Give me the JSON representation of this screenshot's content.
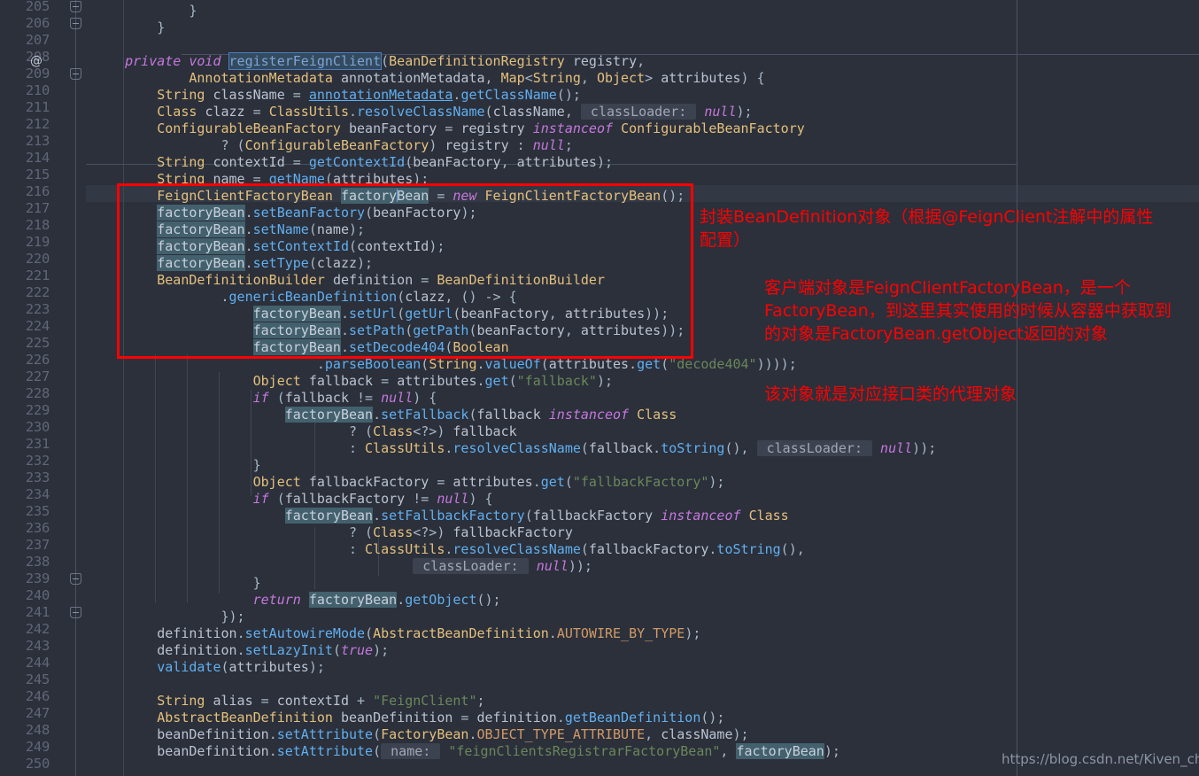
{
  "editor": {
    "theme": "darcula",
    "background": "#2b303b",
    "gutter_background": "#2b303b",
    "current_line": 216,
    "first_line": 205,
    "last_line": 250,
    "at_marker": "@",
    "line_numbers": [
      205,
      206,
      207,
      208,
      209,
      210,
      211,
      212,
      213,
      214,
      215,
      216,
      217,
      218,
      219,
      220,
      221,
      222,
      223,
      224,
      225,
      226,
      227,
      228,
      229,
      230,
      231,
      232,
      233,
      234,
      235,
      236,
      237,
      238,
      239,
      240,
      241,
      242,
      243,
      244,
      245,
      246,
      247,
      248,
      249,
      250
    ],
    "fold_marker_lines": [
      205,
      206,
      209,
      239,
      241
    ],
    "colors": {
      "keyword": "#cc7832",
      "modifier_italic": "#c678dd",
      "type": "#e5c07b",
      "method": "#61afef",
      "string": "#6a8759",
      "constant": "#d19a66",
      "text": "#a9b7c6",
      "highlight_occurrence": "#43606d",
      "selection": "#344a5e",
      "param_hint_bg": "#3c4250",
      "annotation_red": "#ff0000",
      "gutter_text": "#606676"
    }
  },
  "code": {
    "lines": [
      {
        "n": 205,
        "text": "            }"
      },
      {
        "n": 206,
        "text": "        }"
      },
      {
        "n": 207,
        "text": ""
      },
      {
        "n": 208,
        "text": "    private void registerFeignClient(BeanDefinitionRegistry registry,"
      },
      {
        "n": 209,
        "text": "            AnnotationMetadata annotationMetadata, Map<String, Object> attributes) {"
      },
      {
        "n": 210,
        "text": "        String className = annotationMetadata.getClassName();"
      },
      {
        "n": 211,
        "text": "        Class clazz = ClassUtils.resolveClassName(className,  classLoader: null);"
      },
      {
        "n": 212,
        "text": "        ConfigurableBeanFactory beanFactory = registry instanceof ConfigurableBeanFactory"
      },
      {
        "n": 213,
        "text": "                ? (ConfigurableBeanFactory) registry : null;"
      },
      {
        "n": 214,
        "text": "        String contextId = getContextId(beanFactory, attributes);"
      },
      {
        "n": 215,
        "text": "        String name = getName(attributes);"
      },
      {
        "n": 216,
        "text": "        FeignClientFactoryBean factoryBean = new FeignClientFactoryBean();"
      },
      {
        "n": 217,
        "text": "        factoryBean.setBeanFactory(beanFactory);"
      },
      {
        "n": 218,
        "text": "        factoryBean.setName(name);"
      },
      {
        "n": 219,
        "text": "        factoryBean.setContextId(contextId);"
      },
      {
        "n": 220,
        "text": "        factoryBean.setType(clazz);"
      },
      {
        "n": 221,
        "text": "        BeanDefinitionBuilder definition = BeanDefinitionBuilder"
      },
      {
        "n": 222,
        "text": "                .genericBeanDefinition(clazz, () -> {"
      },
      {
        "n": 223,
        "text": "                    factoryBean.setUrl(getUrl(beanFactory, attributes));"
      },
      {
        "n": 224,
        "text": "                    factoryBean.setPath(getPath(beanFactory, attributes));"
      },
      {
        "n": 225,
        "text": "                    factoryBean.setDecode404(Boolean"
      },
      {
        "n": 226,
        "text": "                            .parseBoolean(String.valueOf(attributes.get(\"decode404\"))));"
      },
      {
        "n": 227,
        "text": "                    Object fallback = attributes.get(\"fallback\");"
      },
      {
        "n": 228,
        "text": "                    if (fallback != null) {"
      },
      {
        "n": 229,
        "text": "                        factoryBean.setFallback(fallback instanceof Class"
      },
      {
        "n": 230,
        "text": "                                ? (Class<?>) fallback"
      },
      {
        "n": 231,
        "text": "                                : ClassUtils.resolveClassName(fallback.toString(),  classLoader: null));"
      },
      {
        "n": 232,
        "text": "                    }"
      },
      {
        "n": 233,
        "text": "                    Object fallbackFactory = attributes.get(\"fallbackFactory\");"
      },
      {
        "n": 234,
        "text": "                    if (fallbackFactory != null) {"
      },
      {
        "n": 235,
        "text": "                        factoryBean.setFallbackFactory(fallbackFactory instanceof Class"
      },
      {
        "n": 236,
        "text": "                                ? (Class<?>) fallbackFactory"
      },
      {
        "n": 237,
        "text": "                                : ClassUtils.resolveClassName(fallbackFactory.toString(),"
      },
      {
        "n": 238,
        "text": "                                         classLoader: null));"
      },
      {
        "n": 239,
        "text": "                    }"
      },
      {
        "n": 240,
        "text": "                    return factoryBean.getObject();"
      },
      {
        "n": 241,
        "text": "                });"
      },
      {
        "n": 242,
        "text": "        definition.setAutowireMode(AbstractBeanDefinition.AUTOWIRE_BY_TYPE);"
      },
      {
        "n": 243,
        "text": "        definition.setLazyInit(true);"
      },
      {
        "n": 244,
        "text": "        validate(attributes);"
      },
      {
        "n": 245,
        "text": ""
      },
      {
        "n": 246,
        "text": "        String alias = contextId + \"FeignClient\";"
      },
      {
        "n": 247,
        "text": "        AbstractBeanDefinition beanDefinition = definition.getBeanDefinition();"
      },
      {
        "n": 248,
        "text": "        beanDefinition.setAttribute(FactoryBean.OBJECT_TYPE_ATTRIBUTE, className);"
      },
      {
        "n": 249,
        "text": "        beanDefinition.setAttribute( name: \"feignClientsRegistrarFactoryBean\", factoryBean);"
      },
      {
        "n": 250,
        "text": ""
      }
    ],
    "selected_symbol": "registerFeignClient",
    "highlighted_occurrences": "factoryBean",
    "parameter_hints": [
      "classLoader:",
      "name:"
    ]
  },
  "annotations": {
    "red_box": {
      "covers_lines": "216-225",
      "color": "#ff0000"
    },
    "notes": [
      {
        "id": "note-1",
        "text": "封装BeanDefinition对象（根据@FeignClient注解中的属性配置）"
      },
      {
        "id": "note-2",
        "text": "客户端对象是FeignClientFactoryBean，是一个FactoryBean，到这里其实使用的时候从容器中获取到的对象是FactoryBean.getObject返回的对象"
      },
      {
        "id": "note-3",
        "text": "该对象就是对应接口类的代理对象"
      }
    ]
  },
  "watermark": {
    "text": "https://blog.csdn.net/Kiven_ch"
  }
}
